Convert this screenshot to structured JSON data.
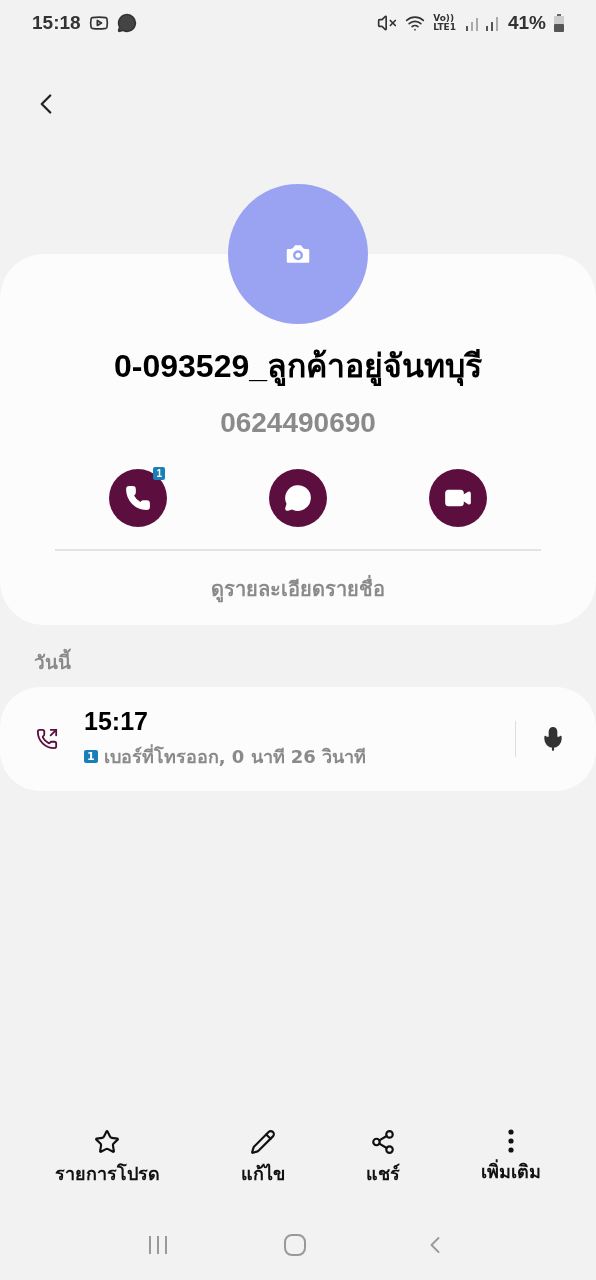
{
  "status_bar": {
    "time": "15:18",
    "network": [
      "Vo))",
      "LTE1"
    ],
    "battery": "41%"
  },
  "contact": {
    "name": "0-093529_ลูกค้าอยู่จันทบุรี",
    "phone": "0624490690",
    "details_link": "ดูรายละเอียดรายชื่อ"
  },
  "actions": [
    {
      "kind": "call",
      "badge": "1"
    },
    {
      "kind": "message"
    },
    {
      "kind": "video"
    }
  ],
  "history": {
    "section": "วันนี้",
    "entries": [
      {
        "time": "15:17",
        "sim": "1",
        "description": "เบอร์ที่โทรออก, 0 นาที 26 วินาที"
      }
    ]
  },
  "bottom_bar": [
    {
      "kind": "star",
      "label": "รายการโปรด"
    },
    {
      "kind": "edit",
      "label": "แก้ไข"
    },
    {
      "kind": "share",
      "label": "แชร์"
    },
    {
      "kind": "more",
      "label": "เพิ่มเติม"
    }
  ]
}
